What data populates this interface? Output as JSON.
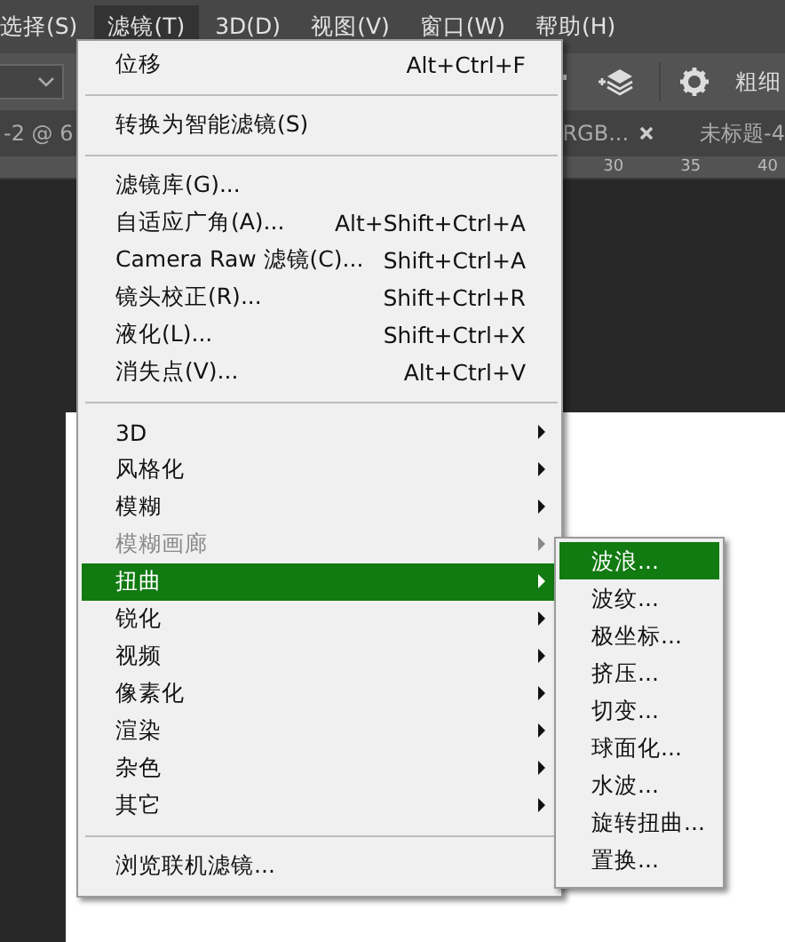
{
  "menu_bar": [
    {
      "label": "选择(S)",
      "selected": false
    },
    {
      "label": "滤镜(T)",
      "selected": true
    },
    {
      "label": "3D(D)",
      "selected": false
    },
    {
      "label": "视图(V)",
      "selected": false
    },
    {
      "label": "窗口(W)",
      "selected": false
    },
    {
      "label": "帮助(H)",
      "selected": false
    }
  ],
  "options_bar": {
    "label": "粗细"
  },
  "document_tabs": [
    {
      "label": "-2 @ 6"
    },
    {
      "label": "RGB..."
    },
    {
      "label": "未标题-4"
    }
  ],
  "ruler": [
    "30",
    "35",
    "40"
  ],
  "filter_menu": [
    [
      {
        "label": "位移",
        "shortcut": "Alt+Ctrl+F",
        "submenu": false,
        "disabled": false,
        "selected": false
      }
    ],
    [
      {
        "label": "转换为智能滤镜(S)",
        "submenu": false,
        "disabled": false,
        "selected": false
      }
    ],
    [
      {
        "label": "滤镜库(G)...",
        "submenu": false,
        "disabled": false,
        "selected": false
      },
      {
        "label": "自适应广角(A)...",
        "shortcut": "Alt+Shift+Ctrl+A",
        "submenu": false,
        "disabled": false,
        "selected": false
      },
      {
        "label": "Camera Raw 滤镜(C)...",
        "shortcut": "Shift+Ctrl+A",
        "submenu": false,
        "disabled": false,
        "selected": false
      },
      {
        "label": "镜头校正(R)...",
        "shortcut": "Shift+Ctrl+R",
        "submenu": false,
        "disabled": false,
        "selected": false
      },
      {
        "label": "液化(L)...",
        "shortcut": "Shift+Ctrl+X",
        "submenu": false,
        "disabled": false,
        "selected": false
      },
      {
        "label": "消失点(V)...",
        "shortcut": "Alt+Ctrl+V",
        "submenu": false,
        "disabled": false,
        "selected": false
      }
    ],
    [
      {
        "label": "3D",
        "submenu": true,
        "disabled": false,
        "selected": false
      },
      {
        "label": "风格化",
        "submenu": true,
        "disabled": false,
        "selected": false
      },
      {
        "label": "模糊",
        "submenu": true,
        "disabled": false,
        "selected": false
      },
      {
        "label": "模糊画廊",
        "submenu": true,
        "disabled": true,
        "selected": false
      },
      {
        "label": "扭曲",
        "submenu": true,
        "disabled": false,
        "selected": true
      },
      {
        "label": "锐化",
        "submenu": true,
        "disabled": false,
        "selected": false
      },
      {
        "label": "视频",
        "submenu": true,
        "disabled": false,
        "selected": false
      },
      {
        "label": "像素化",
        "submenu": true,
        "disabled": false,
        "selected": false
      },
      {
        "label": "渲染",
        "submenu": true,
        "disabled": false,
        "selected": false
      },
      {
        "label": "杂色",
        "submenu": true,
        "disabled": false,
        "selected": false
      },
      {
        "label": "其它",
        "submenu": true,
        "disabled": false,
        "selected": false
      }
    ],
    [
      {
        "label": "浏览联机滤镜...",
        "submenu": false,
        "disabled": false,
        "selected": false
      }
    ]
  ],
  "distort_submenu": [
    {
      "label": "波浪...",
      "selected": true
    },
    {
      "label": "波纹...",
      "selected": false
    },
    {
      "label": "极坐标...",
      "selected": false
    },
    {
      "label": "挤压...",
      "selected": false
    },
    {
      "label": "切变...",
      "selected": false
    },
    {
      "label": "球面化...",
      "selected": false
    },
    {
      "label": "水波...",
      "selected": false
    },
    {
      "label": "旋转扭曲...",
      "selected": false
    },
    {
      "label": "置换...",
      "selected": false
    }
  ]
}
